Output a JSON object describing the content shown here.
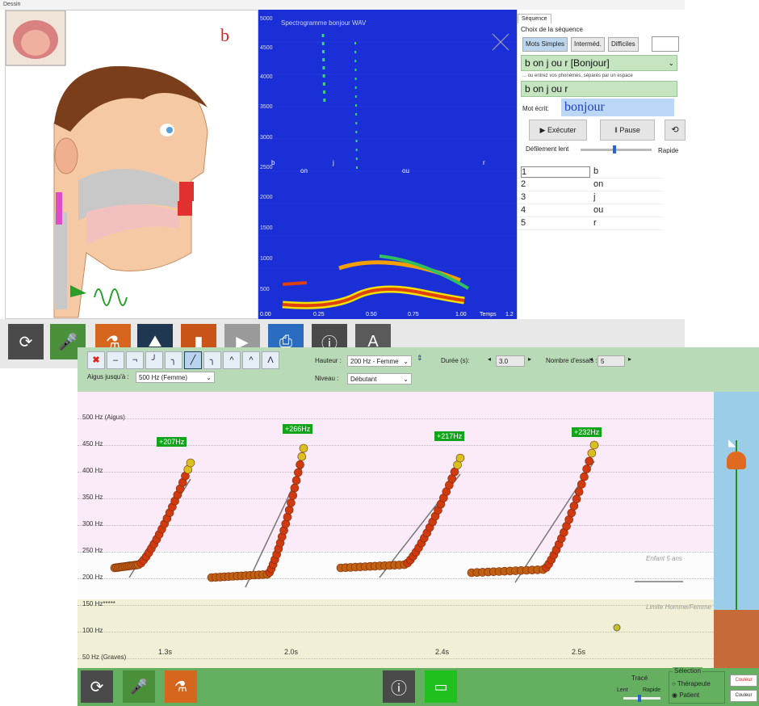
{
  "top_window": {
    "title": "Dessin",
    "phoneme_letter": "b",
    "spectrogram": {
      "title": "Spectrogramme bonjour WAV",
      "y_ticks": [
        "5000",
        "4500",
        "4000",
        "3500",
        "3000",
        "2500",
        "2000",
        "1500",
        "1000",
        "500"
      ],
      "x_ticks": [
        "0.00",
        "0.25",
        "0.50",
        "0.75",
        "1.00"
      ],
      "x_label": "Temps",
      "x_end": "1.2",
      "phoneme_markers": [
        "b",
        "on",
        "j",
        "ou",
        "r"
      ]
    },
    "sequence": {
      "tab": "Séquence",
      "heading": "Choix de la séquence",
      "level_buttons": [
        "Mots Simples",
        "Interméd.",
        "Difficiles"
      ],
      "selected_sequence": "b on j ou r [Bonjour]",
      "hint": "... ou entrez vos phonèmes, séparés par un espace",
      "phoneme_input": "b on j ou r",
      "written_label": "Mot écrit:",
      "written_word": "bonjour",
      "run_button": "Exécuter",
      "pause_button": "Pause",
      "scroll_slow": "Défilement lent",
      "scroll_fast": "Rapide",
      "phonemes": [
        {
          "n": "1",
          "p": "b"
        },
        {
          "n": "2",
          "p": "on"
        },
        {
          "n": "3",
          "p": "j"
        },
        {
          "n": "4",
          "p": "ou"
        },
        {
          "n": "5",
          "p": "r"
        }
      ]
    },
    "toolbar_icons": [
      "replay-icon",
      "microphone-icon",
      "spray-icon",
      "tooth-icon",
      "chart-icon",
      "video-icon",
      "print-icon",
      "info-icon",
      "text-style-icon"
    ]
  },
  "bottom_window": {
    "controls": {
      "aigus_label": "Aigus jusqu'à :",
      "aigus_value": "500 Hz (Femme)",
      "hauteur_label": "Hauteur :",
      "hauteur_value": "200 Hz - Femme",
      "niveau_label": "Niveau :",
      "niveau_value": "Débutant",
      "duree_label": "Durée (s):",
      "duree_value": "3.0",
      "essais_label": "Nombre d'essais :",
      "essais_value": "5"
    },
    "y_axis_labels": [
      {
        "label": "500 Hz (Aigus)",
        "hz": 500
      },
      {
        "label": "450 Hz",
        "hz": 450
      },
      {
        "label": "400 Hz",
        "hz": 400
      },
      {
        "label": "350 Hz",
        "hz": 350
      },
      {
        "label": "300 Hz",
        "hz": 300
      },
      {
        "label": "250 Hz",
        "hz": 250
      },
      {
        "label": "200 Hz",
        "hz": 200
      },
      {
        "label": "150 Hz*****",
        "hz": 150
      },
      {
        "label": "100 Hz",
        "hz": 100
      },
      {
        "label": "50 Hz (Graves)",
        "hz": 50
      }
    ],
    "band_labels": {
      "child": "Enfant 5 ans",
      "man_woman": "Limite Homme/Femme"
    },
    "attempts": [
      {
        "gain": "+207Hz",
        "duration": "1.3s"
      },
      {
        "gain": "+266Hz",
        "duration": "2.0s"
      },
      {
        "gain": "+217Hz",
        "duration": "2.4s"
      },
      {
        "gain": "+232Hz",
        "duration": "2.5s"
      }
    ],
    "bottom_bar": {
      "trace_label": "Tracé",
      "slow": "Lent",
      "fast": "Rapide",
      "selection_label": "Sélection",
      "therapist": "Thérapeute",
      "patient": "Patient",
      "color1": "Couleur",
      "color2": "Couleur"
    },
    "colors": {
      "controls_bg": "#b8dab6",
      "bottom_bar": "#64b060",
      "badge": "#12a51c",
      "spectrogram": "#1a2fd6"
    }
  }
}
